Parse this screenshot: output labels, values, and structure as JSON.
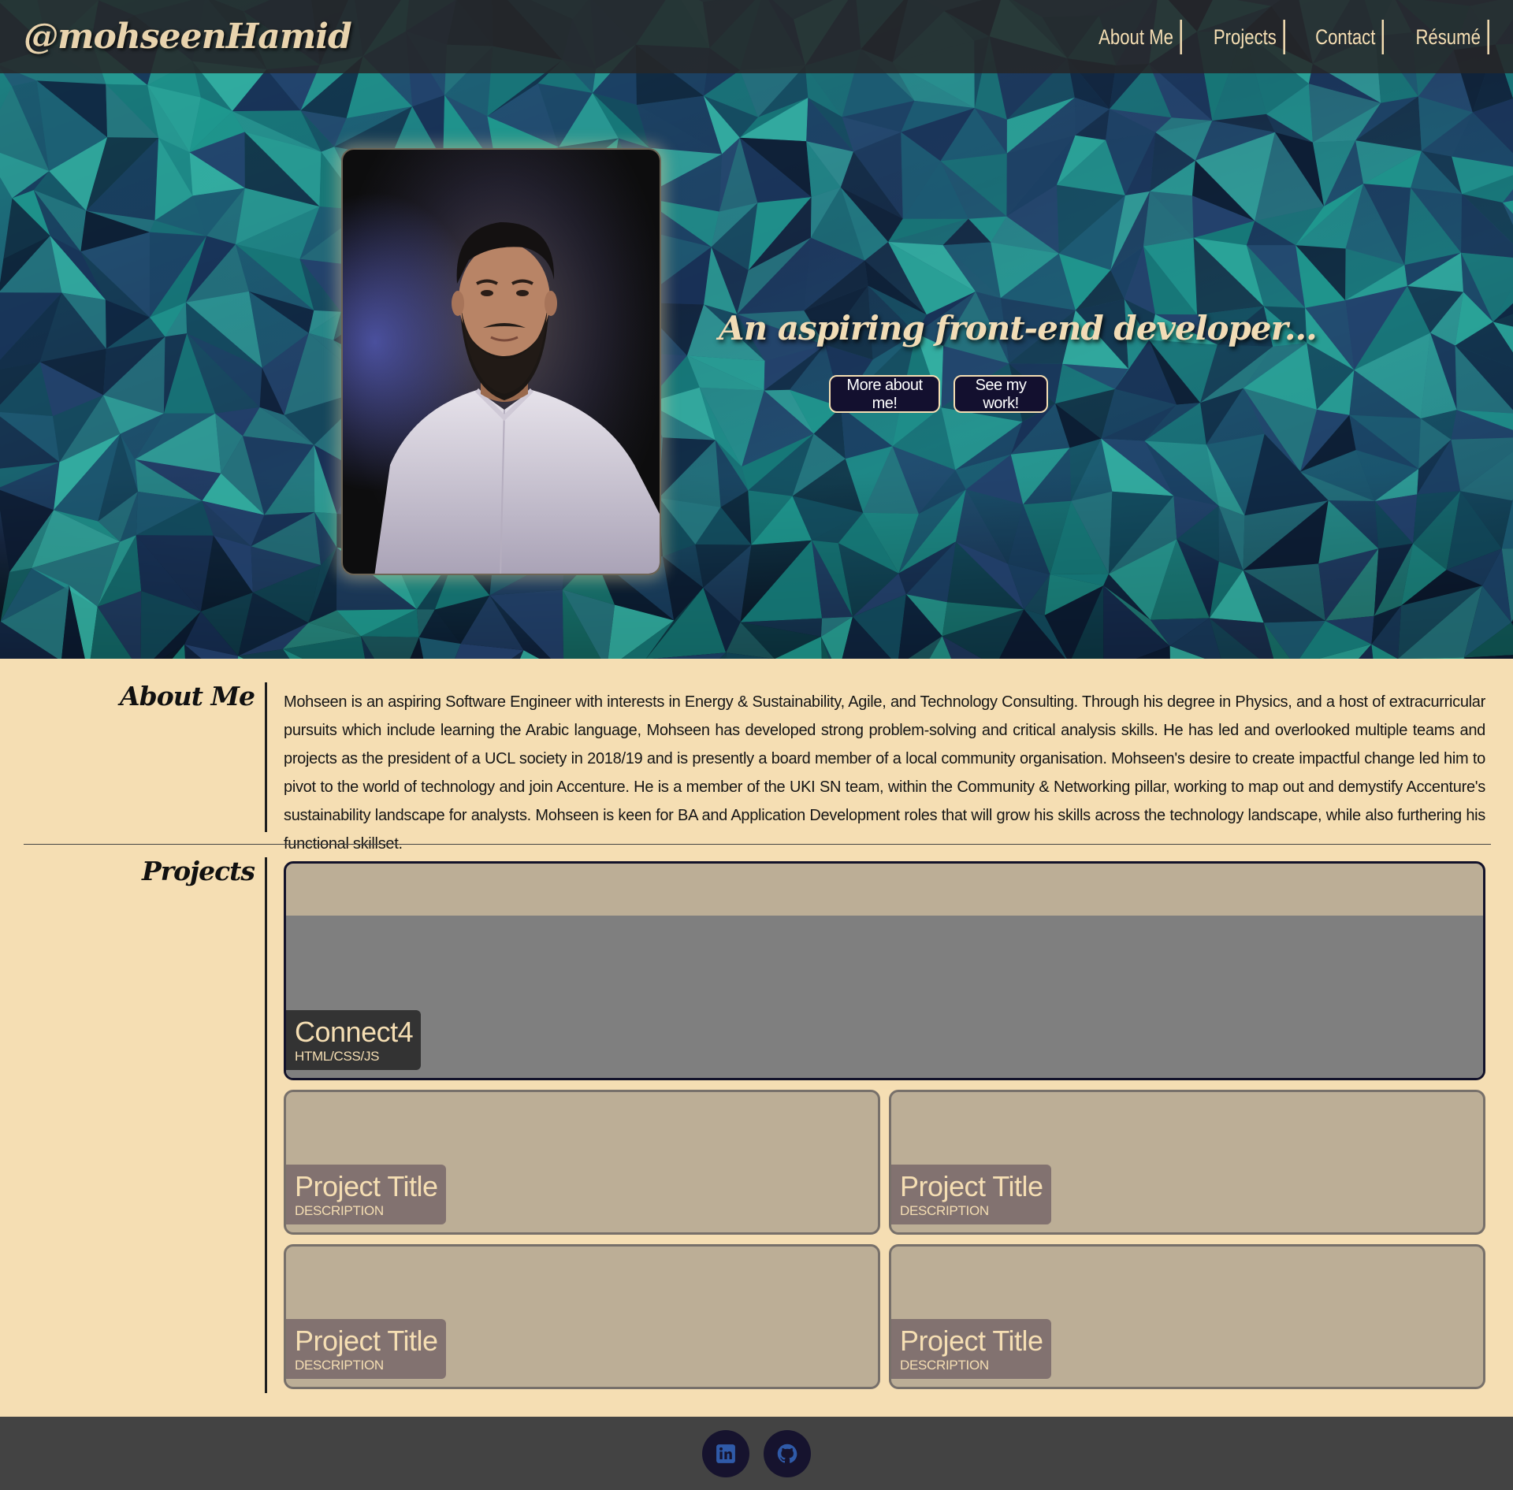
{
  "brand": "@mohseenHamid",
  "nav": {
    "items": [
      "About Me",
      "Projects",
      "Contact",
      "Résumé"
    ]
  },
  "hero": {
    "tagline": "An aspiring front-end developer...",
    "buttons": {
      "about": "More about me!",
      "work": "See my work!"
    }
  },
  "about": {
    "title": "About Me",
    "text": "Mohseen is an aspiring Software Engineer with interests in Energy & Sustainability, Agile, and Technology Consulting. Through his degree in Physics, and a host of extracurricular pursuits which include learning the Arabic language, Mohseen has developed strong problem-solving and critical analysis skills. He has led and overlooked multiple teams and projects as the president of a UCL society in 2018/19 and is presently a board member of a local community organisation. Mohseen's desire to create impactful change led him to pivot to the world of technology and join Accenture. He is a member of the UKI SN team, within the Community & Networking pillar, working to map out and demystify Accenture's sustainability landscape for analysts. Mohseen is keen for BA and Application Development roles that will grow his skills across the technology landscape, while also furthering his functional skillset."
  },
  "projects": {
    "title": "Projects",
    "items": [
      {
        "title": "Connect4",
        "description": "HTML/CSS/JS"
      },
      {
        "title": "Project Title",
        "description": "DESCRIPTION"
      },
      {
        "title": "Project Title",
        "description": "DESCRIPTION"
      },
      {
        "title": "Project Title",
        "description": "DESCRIPTION"
      },
      {
        "title": "Project Title",
        "description": "DESCRIPTION"
      }
    ]
  },
  "footer": {
    "icons": [
      "linkedin-icon",
      "github-icon"
    ]
  },
  "colors": {
    "page_background": "#f5deb3",
    "navbar": "#262628",
    "accent": "#f5deb3",
    "button": "#13102f",
    "footer": "#434343",
    "card": "#bcae96",
    "caption": "#827270"
  }
}
